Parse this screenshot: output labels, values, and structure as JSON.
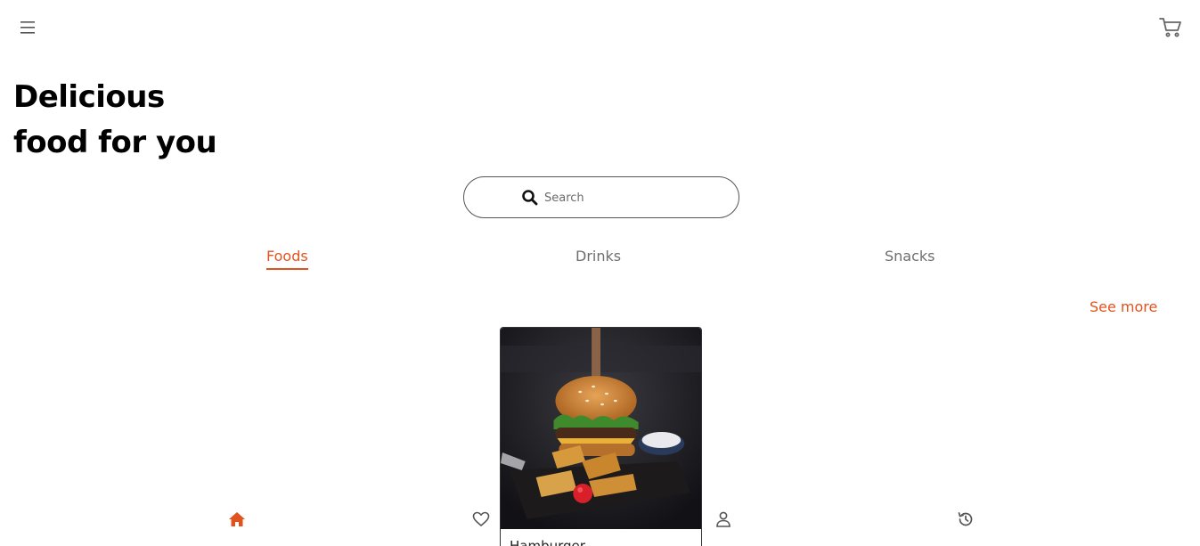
{
  "header": {
    "menu_icon": "menu-icon",
    "cart_icon": "cart-icon"
  },
  "hero": {
    "line1": "Delicious",
    "line2": "food for you"
  },
  "search": {
    "icon": "search-icon",
    "placeholder": "Search",
    "value": ""
  },
  "tabs": [
    {
      "label": "Foods",
      "active": true
    },
    {
      "label": "Drinks",
      "active": false
    },
    {
      "label": "Snacks",
      "active": false
    }
  ],
  "see_more": {
    "label": "See more"
  },
  "card": {
    "image": "burger-photo",
    "name": "Hamburger"
  },
  "bottom_nav": [
    {
      "icon": "home-icon",
      "active": true
    },
    {
      "icon": "heart-icon",
      "active": false
    },
    {
      "icon": "user-icon",
      "active": false
    },
    {
      "icon": "history-icon",
      "active": false
    }
  ],
  "colors": {
    "accent": "#e0531f",
    "text": "#000000",
    "muted": "#6e6e6e",
    "background": "#ffffff"
  }
}
